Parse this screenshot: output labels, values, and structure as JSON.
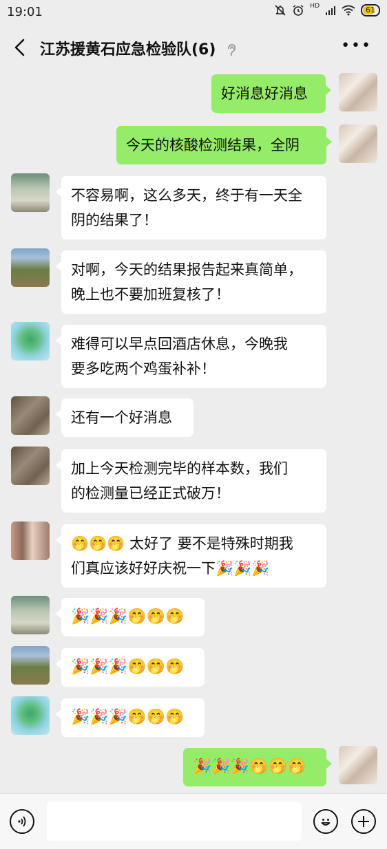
{
  "status_bar": {
    "time": "19:01",
    "hd": "HD",
    "battery": "61"
  },
  "header": {
    "title": "江苏援黄石应急检验队(6)",
    "more": "•••"
  },
  "messages": [
    {
      "side": "right",
      "text": "好消息好消息"
    },
    {
      "side": "right",
      "text": "今天的核酸检测结果，全阴"
    },
    {
      "side": "left",
      "line1": "不容易啊，这么多天，终于有一天全",
      "line2": "阴的结果了！"
    },
    {
      "side": "left",
      "line1": "对啊，今天的结果报告起来真简单，",
      "line2": "晚上也不要加班复核了！"
    },
    {
      "side": "left",
      "line1": "难得可以早点回酒店休息，今晚我",
      "line2": "要多吃两个鸡蛋补补！"
    },
    {
      "side": "left",
      "text": "还有一个好消息"
    },
    {
      "side": "left",
      "line1": "加上今天检测完毕的样本数，我们",
      "line2": "的检测量已经正式破万！"
    },
    {
      "side": "left",
      "line1": "🤭🤭🤭 太好了 要不是特殊时期我",
      "line2": "们真应该好好庆祝一下🎉🎉🎉"
    },
    {
      "side": "left",
      "text": "🎉🎉🎉🤭🤭🤭"
    },
    {
      "side": "left",
      "text": "🎉🎉🎉🤭🤭🤭"
    },
    {
      "side": "left",
      "text": "🎉🎉🎉🤭🤭🤭"
    },
    {
      "side": "right",
      "text": "🎉🎉🎉🤭🤭🤭"
    }
  ],
  "colors": {
    "self_bubble": "#95ec69",
    "other_bubble": "#ffffff",
    "background": "#ededed"
  },
  "icons": [
    "back-arrow-icon",
    "ear-icon",
    "more-icon",
    "voice-icon",
    "emoji-icon",
    "plus-icon"
  ]
}
